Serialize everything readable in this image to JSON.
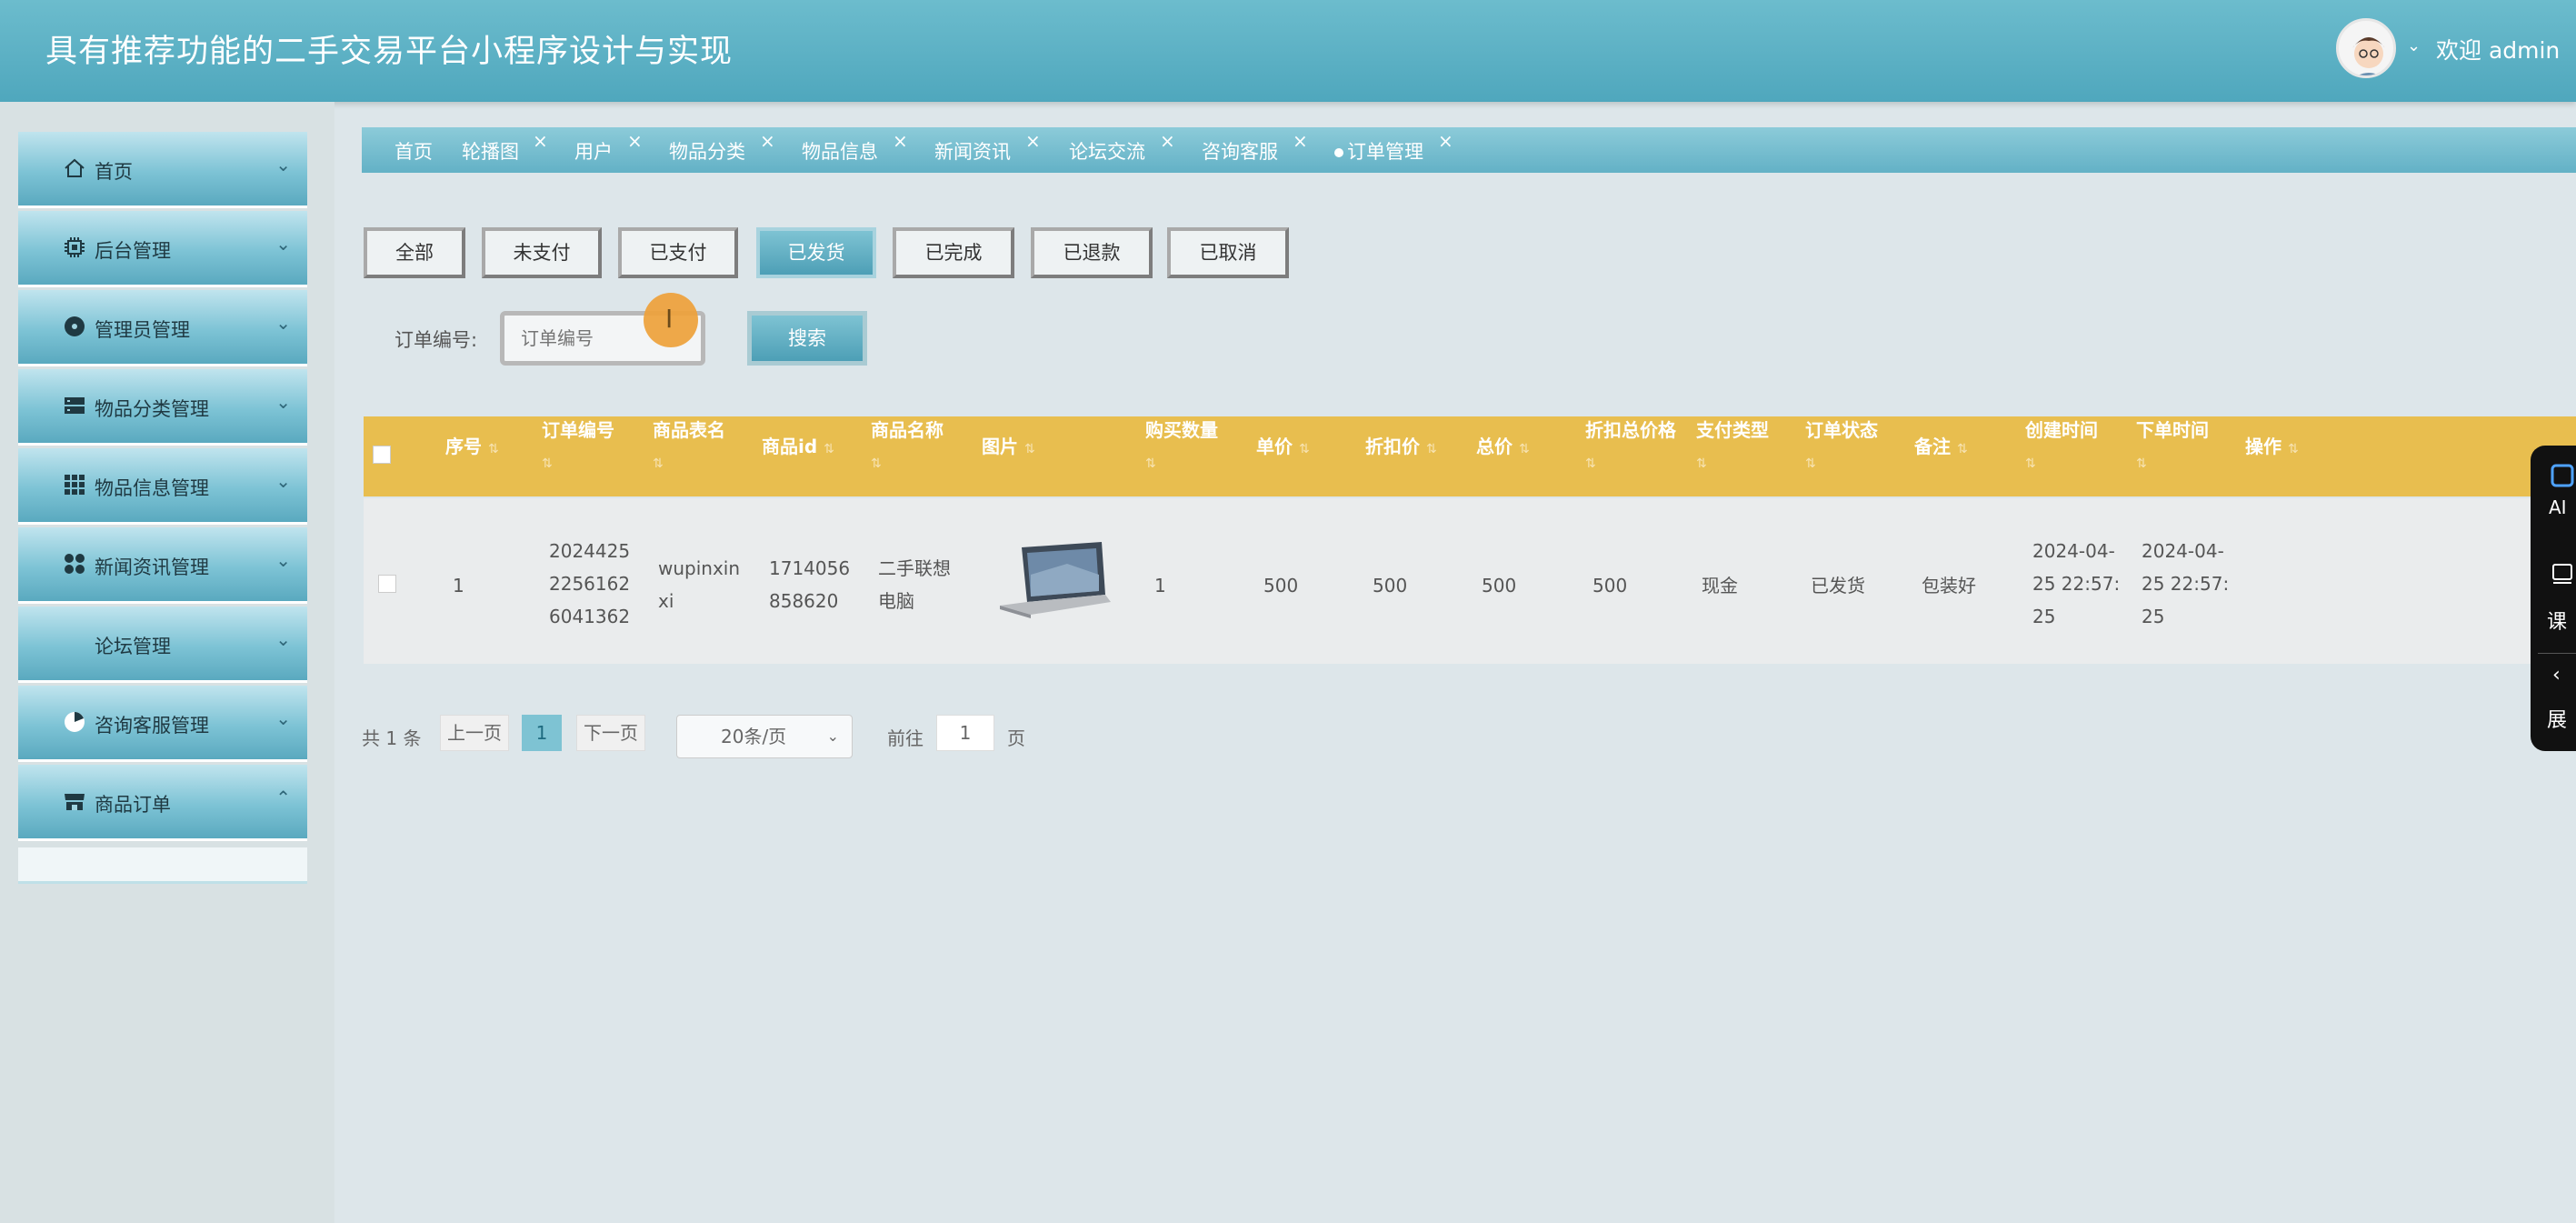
{
  "app": {
    "title": "具有推荐功能的二手交易平台小程序设计与实现",
    "welcome": "欢迎 admin"
  },
  "sidebar": {
    "items": [
      {
        "label": "首页",
        "icon": "home-icon",
        "chevron": "⌄"
      },
      {
        "label": "后台管理",
        "icon": "chip-icon",
        "chevron": "⌄"
      },
      {
        "label": "管理员管理",
        "icon": "disc-icon",
        "chevron": "⌄"
      },
      {
        "label": "物品分类管理",
        "icon": "server-icon",
        "chevron": "⌄"
      },
      {
        "label": "物品信息管理",
        "icon": "grid-icon",
        "chevron": "⌄"
      },
      {
        "label": "新闻资讯管理",
        "icon": "apps-icon",
        "chevron": "⌄"
      },
      {
        "label": "论坛管理",
        "icon": "",
        "chevron": "⌄"
      },
      {
        "label": "咨询客服管理",
        "icon": "pie-icon",
        "chevron": "⌄"
      },
      {
        "label": "商品订单",
        "icon": "store-icon",
        "chevron": "⌃"
      }
    ]
  },
  "tabs": [
    {
      "label": "首页"
    },
    {
      "label": "轮播图"
    },
    {
      "label": "用户"
    },
    {
      "label": "物品分类"
    },
    {
      "label": "物品信息"
    },
    {
      "label": "新闻资讯"
    },
    {
      "label": "论坛交流"
    },
    {
      "label": "咨询客服"
    },
    {
      "label": "订单管理"
    }
  ],
  "tab_close": "×",
  "filters": [
    "全部",
    "未支付",
    "已支付",
    "已发货",
    "已完成",
    "已退款",
    "已取消"
  ],
  "active_filter": "已发货",
  "search": {
    "label": "订单编号:",
    "placeholder": "订单编号",
    "button": "搜索"
  },
  "table": {
    "headers": [
      "序号",
      "订单编号",
      "商品表名",
      "商品id",
      "商品名称",
      "图片",
      "购买数量",
      "单价",
      "折扣价",
      "总价",
      "折扣总价格",
      "支付类型",
      "订单状态",
      "备注",
      "创建时间",
      "下单时间",
      "操作"
    ],
    "rows": [
      {
        "index": "1",
        "order_no": [
          "2024425",
          "2256162",
          "6041362"
        ],
        "table_name": [
          "wupinxin",
          "xi"
        ],
        "goods_id": [
          "1714056",
          "858620"
        ],
        "goods_name": [
          "二手联想",
          "电脑"
        ],
        "image": "laptop-photo",
        "quantity": "1",
        "price": "500",
        "discount_price": "500",
        "total": "500",
        "discount_total": "500",
        "pay_type": "现金",
        "status": "已发货",
        "remark": "包装好",
        "created": [
          "2024-04-",
          "25 22:57:",
          "25"
        ],
        "ordered": [
          "2024-04-",
          "25 22:57:",
          "25"
        ]
      }
    ]
  },
  "pagination": {
    "total": "共 1 条",
    "prev": "上一页",
    "current": "1",
    "next": "下一页",
    "page_size": "20条/页",
    "goto_label": "前往",
    "goto_value": "1",
    "page_suffix": "页"
  },
  "side_panel": {
    "items": [
      "AI",
      "课",
      "展"
    ]
  }
}
